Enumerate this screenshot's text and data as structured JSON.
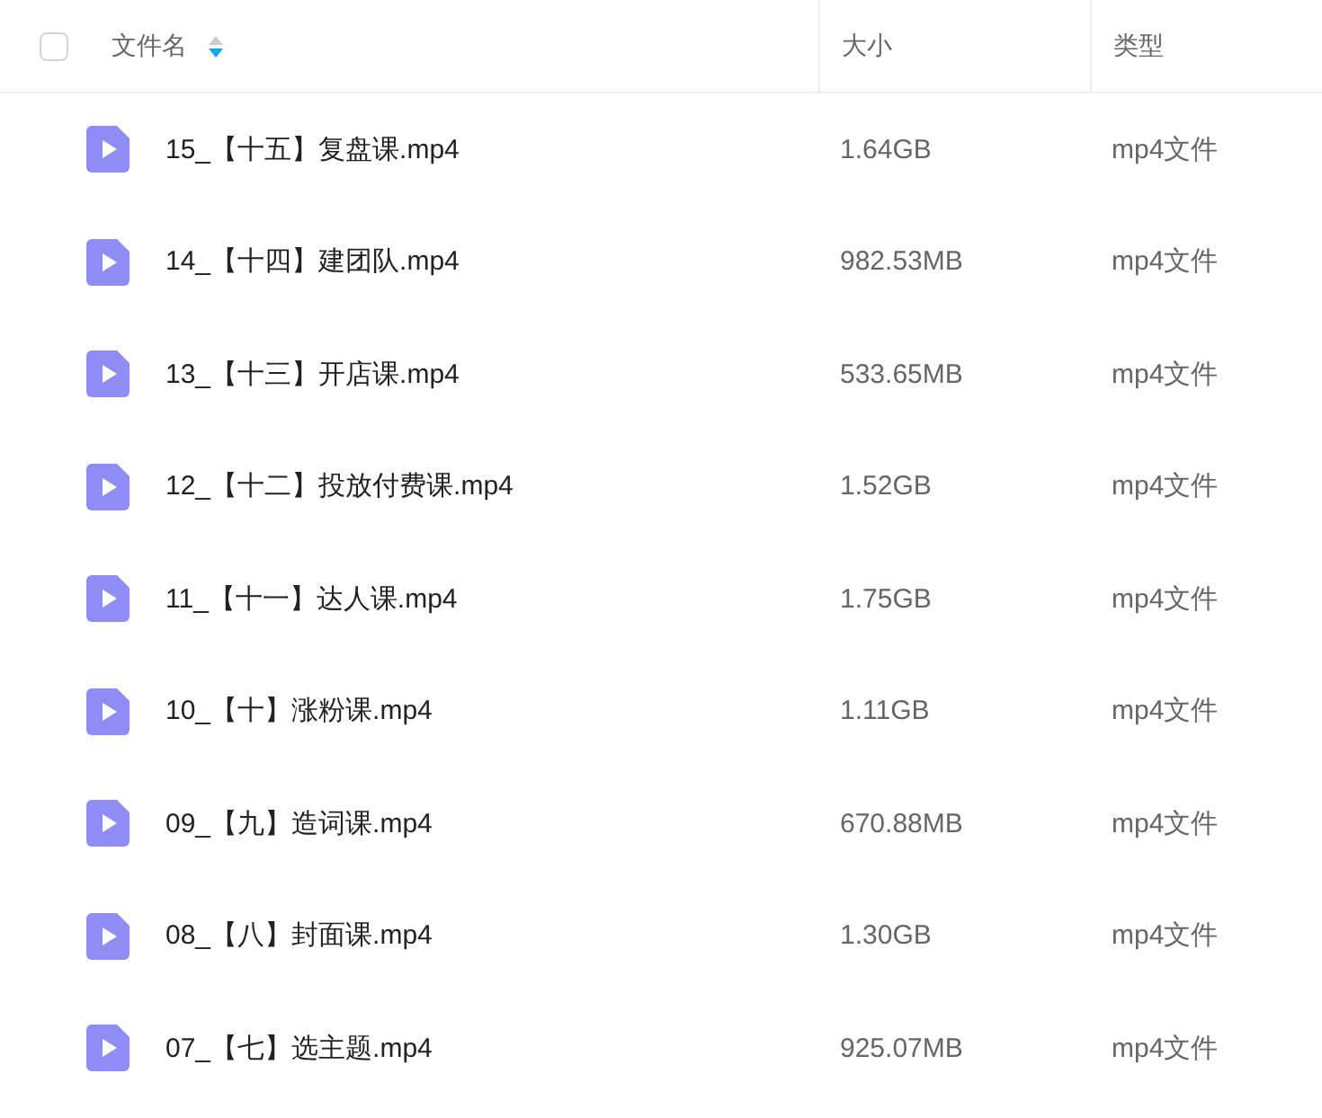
{
  "header": {
    "select_all": {
      "checked": false
    },
    "columns": [
      {
        "label": "文件名",
        "sorted_descending": true
      },
      {
        "label": "大小"
      },
      {
        "label": "类型"
      }
    ]
  },
  "files": [
    {
      "name": "15_【十五】复盘课.mp4",
      "size": "1.64GB",
      "type": "mp4文件"
    },
    {
      "name": "14_【十四】建团队.mp4",
      "size": "982.53MB",
      "type": "mp4文件"
    },
    {
      "name": "13_【十三】开店课.mp4",
      "size": "533.65MB",
      "type": "mp4文件"
    },
    {
      "name": "12_【十二】投放付费课.mp4",
      "size": "1.52GB",
      "type": "mp4文件"
    },
    {
      "name": "11_【十一】达人课.mp4",
      "size": "1.75GB",
      "type": "mp4文件"
    },
    {
      "name": "10_【十】涨粉课.mp4",
      "size": "1.11GB",
      "type": "mp4文件"
    },
    {
      "name": "09_【九】造词课.mp4",
      "size": "670.88MB",
      "type": "mp4文件"
    },
    {
      "name": "08_【八】封面课.mp4",
      "size": "1.30GB",
      "type": "mp4文件"
    },
    {
      "name": "07_【七】选主题.mp4",
      "size": "925.07MB",
      "type": "mp4文件"
    }
  ]
}
